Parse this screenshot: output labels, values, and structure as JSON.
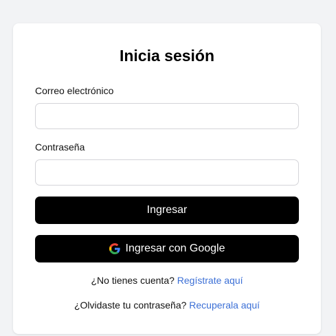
{
  "login_form": {
    "title": "Inicia sesión",
    "email_label": "Correo electrónico",
    "email_value": "",
    "password_label": "Contraseña",
    "password_value": "",
    "login_button_label": "Ingresar",
    "google_button_label": "Ingresar con Google",
    "google_icon": "google-g-icon"
  },
  "links": {
    "signup_prompt": "¿No tienes cuenta?",
    "signup_link": "Regístrate aquí",
    "recover_prompt": "¿Olvidaste tu contraseña?",
    "recover_link": "Recuperala aquí"
  },
  "colors": {
    "background": "#f2f3f5",
    "card": "#ffffff",
    "button": "#000000",
    "link": "#3b6fd6"
  }
}
